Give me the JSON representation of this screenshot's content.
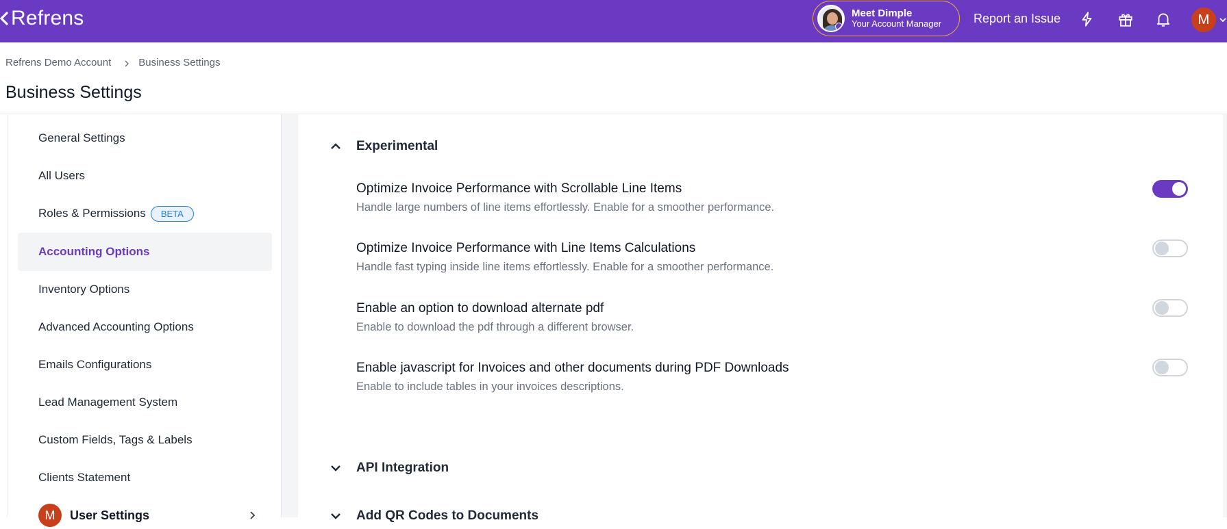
{
  "app": {
    "logo_text": "Refrens",
    "account_manager": {
      "name": "Meet Dimple",
      "role": "Your Account Manager"
    },
    "report_label": "Report an Issue",
    "user_initial": "M",
    "brand_color": "#6a3bc2"
  },
  "breadcrumb": {
    "root": "Refrens Demo Account",
    "current": "Business Settings"
  },
  "page_title": "Business Settings",
  "sidebar": {
    "items": [
      {
        "label": "General Settings",
        "active": false
      },
      {
        "label": "All Users",
        "active": false
      },
      {
        "label": "Roles & Permissions",
        "badge": "BETA",
        "active": false
      },
      {
        "label": "Accounting Options",
        "active": true
      },
      {
        "label": "Inventory Options",
        "active": false
      },
      {
        "label": "Advanced Accounting Options",
        "active": false
      },
      {
        "label": "Emails Configurations",
        "active": false
      },
      {
        "label": "Lead Management System",
        "active": false
      },
      {
        "label": "Custom Fields, Tags & Labels",
        "active": false
      },
      {
        "label": "Clients Statement",
        "active": false
      }
    ],
    "user_settings": {
      "initial": "M",
      "label": "User Settings"
    }
  },
  "main": {
    "experimental": {
      "title": "Experimental",
      "expanded": true,
      "settings": [
        {
          "title": "Optimize Invoice Performance with Scrollable Line Items",
          "description": "Handle large numbers of line items effortlessly. Enable for a smoother performance.",
          "enabled": true
        },
        {
          "title": "Optimize Invoice Performance with Line Items Calculations",
          "description": "Handle fast typing inside line items effortlessly. Enable for a smoother performance.",
          "enabled": false
        },
        {
          "title": "Enable an option to download alternate pdf",
          "description": "Enable to download the pdf through a different browser.",
          "enabled": false
        },
        {
          "title": "Enable javascript for Invoices and other documents during PDF Downloads",
          "description": "Enable to include tables in your invoices descriptions.",
          "enabled": false
        }
      ]
    },
    "api_integration": {
      "title": "API Integration",
      "expanded": false
    },
    "qr_codes": {
      "title": "Add QR Codes to Documents",
      "expanded": false
    }
  }
}
